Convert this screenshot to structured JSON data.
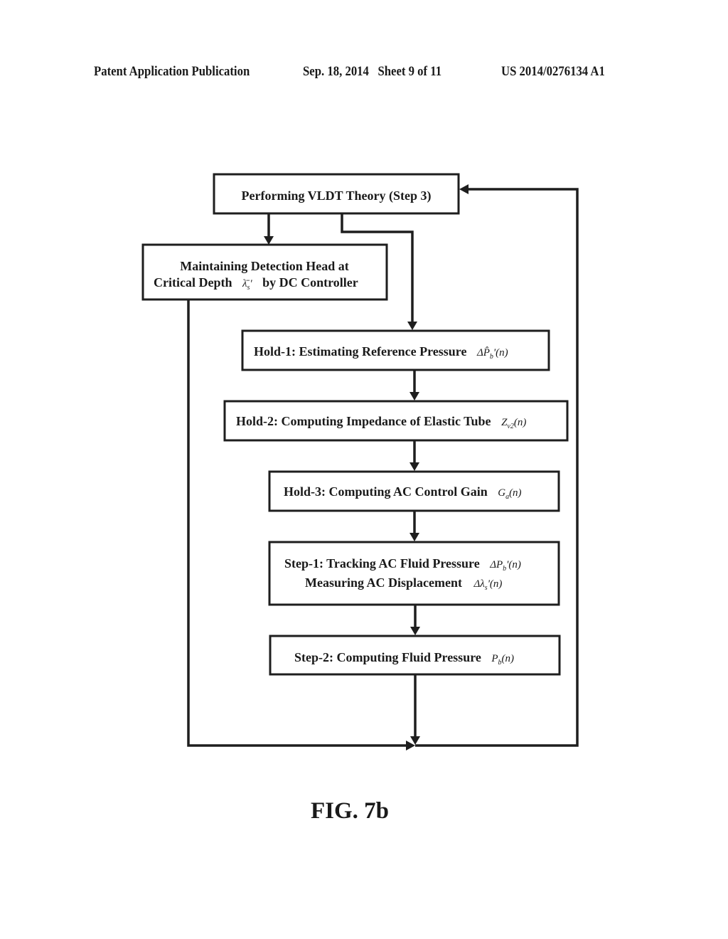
{
  "header": {
    "publication_type": "Patent Application Publication",
    "date_sheet": "Sep. 18, 2014   Sheet 9 of 11",
    "patent_number": "US 2014/0276134 A1"
  },
  "figure": {
    "caption": "FIG. 7b",
    "nodes": [
      {
        "id": "vldt",
        "label": "Performing VLDT Theory (Step 3)",
        "symbol": ""
      },
      {
        "id": "maintain",
        "label_line1": "Maintaining Detection Head at",
        "label_line2": "Critical Depth",
        "symbol": "λ̄",
        "symbol_sub": "s",
        "symbol_suffix": "'",
        "label_line2_tail": "by DC Controller"
      },
      {
        "id": "hold1",
        "label": "Hold-1: Estimating Reference Pressure",
        "symbol": "ΔP̂",
        "symbol_sub": "b",
        "symbol_suffix": "'(n)"
      },
      {
        "id": "hold2",
        "label": "Hold-2: Computing Impedance of Elastic Tube",
        "symbol": "Z",
        "symbol_sub": "v2",
        "symbol_suffix": "(n)"
      },
      {
        "id": "hold3",
        "label": "Hold-3: Computing AC Control Gain",
        "symbol": "G",
        "symbol_sub": "a",
        "symbol_suffix": "(n)"
      },
      {
        "id": "step1",
        "label_line1": "Step-1: Tracking AC Fluid Pressure",
        "symbol1": "ΔP",
        "symbol1_sub": "b",
        "symbol1_suffix": "'(n)",
        "label_line2": "Measuring AC Displacement",
        "symbol2": "Δλ",
        "symbol2_sub": "s",
        "symbol2_suffix": "'(n)"
      },
      {
        "id": "step2",
        "label": "Step-2: Computing Fluid Pressure",
        "symbol": "P",
        "symbol_sub": "b",
        "symbol_suffix": "(n)"
      }
    ],
    "edges": [
      {
        "from": "vldt",
        "to": "maintain"
      },
      {
        "from": "vldt",
        "to": "hold1"
      },
      {
        "from": "hold1",
        "to": "hold2"
      },
      {
        "from": "hold2",
        "to": "hold3"
      },
      {
        "from": "hold3",
        "to": "step1"
      },
      {
        "from": "step1",
        "to": "step2"
      },
      {
        "from": "step2",
        "to": "junction"
      },
      {
        "from": "maintain",
        "to": "junction"
      },
      {
        "from": "junction",
        "to": "vldt"
      }
    ]
  }
}
